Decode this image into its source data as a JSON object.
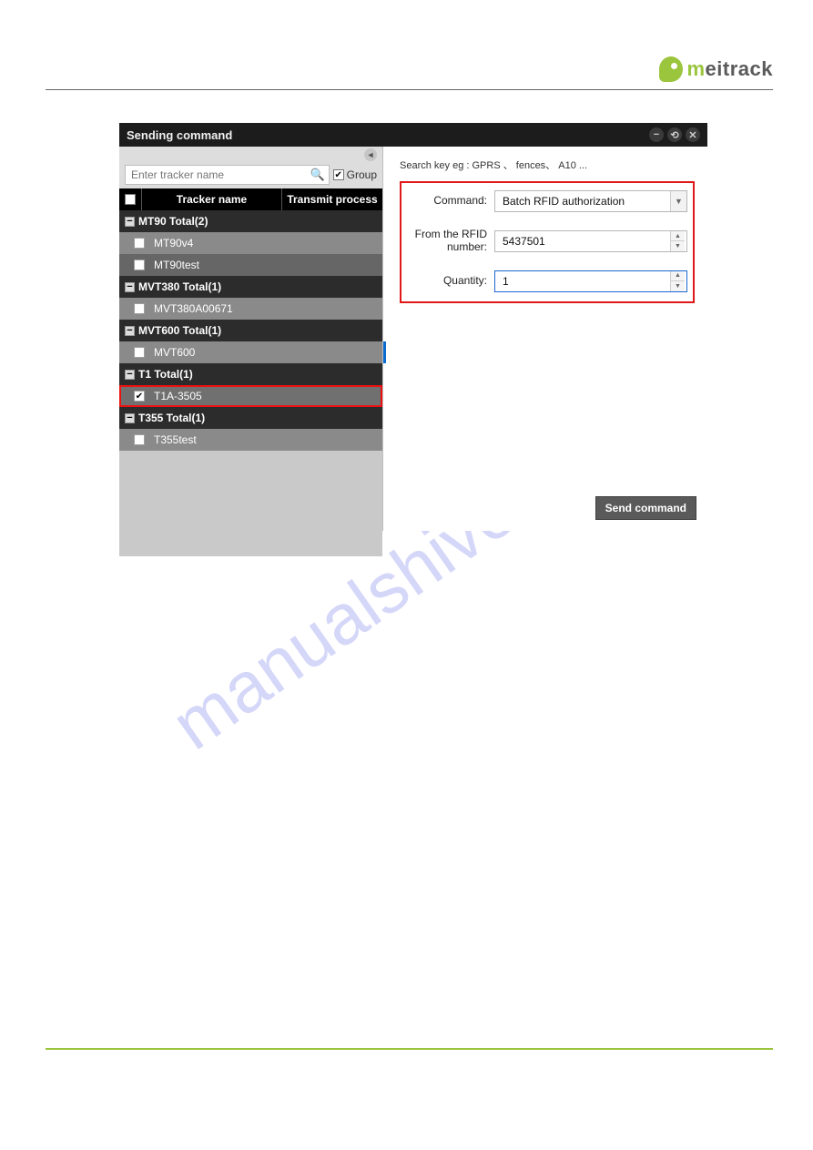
{
  "brand": {
    "name": "meitrack"
  },
  "watermark": "manualshive.com",
  "window": {
    "title": "Sending command",
    "left": {
      "search_placeholder": "Enter tracker name",
      "group_label": "Group",
      "columns": {
        "name": "Tracker name",
        "process": "Transmit process"
      },
      "groups": [
        {
          "label": "MT90 Total(2)",
          "items": [
            {
              "name": "MT90v4",
              "checked": false,
              "shade": "a"
            },
            {
              "name": "MT90test",
              "checked": false,
              "shade": "b"
            }
          ]
        },
        {
          "label": "MVT380 Total(1)",
          "items": [
            {
              "name": "MVT380A00671",
              "checked": false,
              "shade": "a"
            }
          ]
        },
        {
          "label": "MVT600 Total(1)",
          "items": [
            {
              "name": "MVT600",
              "checked": false,
              "shade": "a",
              "marker": true
            }
          ]
        },
        {
          "label": "T1 Total(1)",
          "items": [
            {
              "name": "T1A-3505",
              "checked": true,
              "shade": "c",
              "highlight": true
            }
          ]
        },
        {
          "label": "T355 Total(1)",
          "items": [
            {
              "name": "T355test",
              "checked": false,
              "shade": "a"
            }
          ]
        }
      ]
    },
    "right": {
      "search_hint": "Search key eg : GPRS 、 fences、 A10 ...",
      "command_label": "Command:",
      "command_value": "Batch RFID authorization",
      "rfid_label": "From the RFID number:",
      "rfid_value": "5437501",
      "qty_label": "Quantity:",
      "qty_value": "1",
      "send_label": "Send command"
    }
  }
}
